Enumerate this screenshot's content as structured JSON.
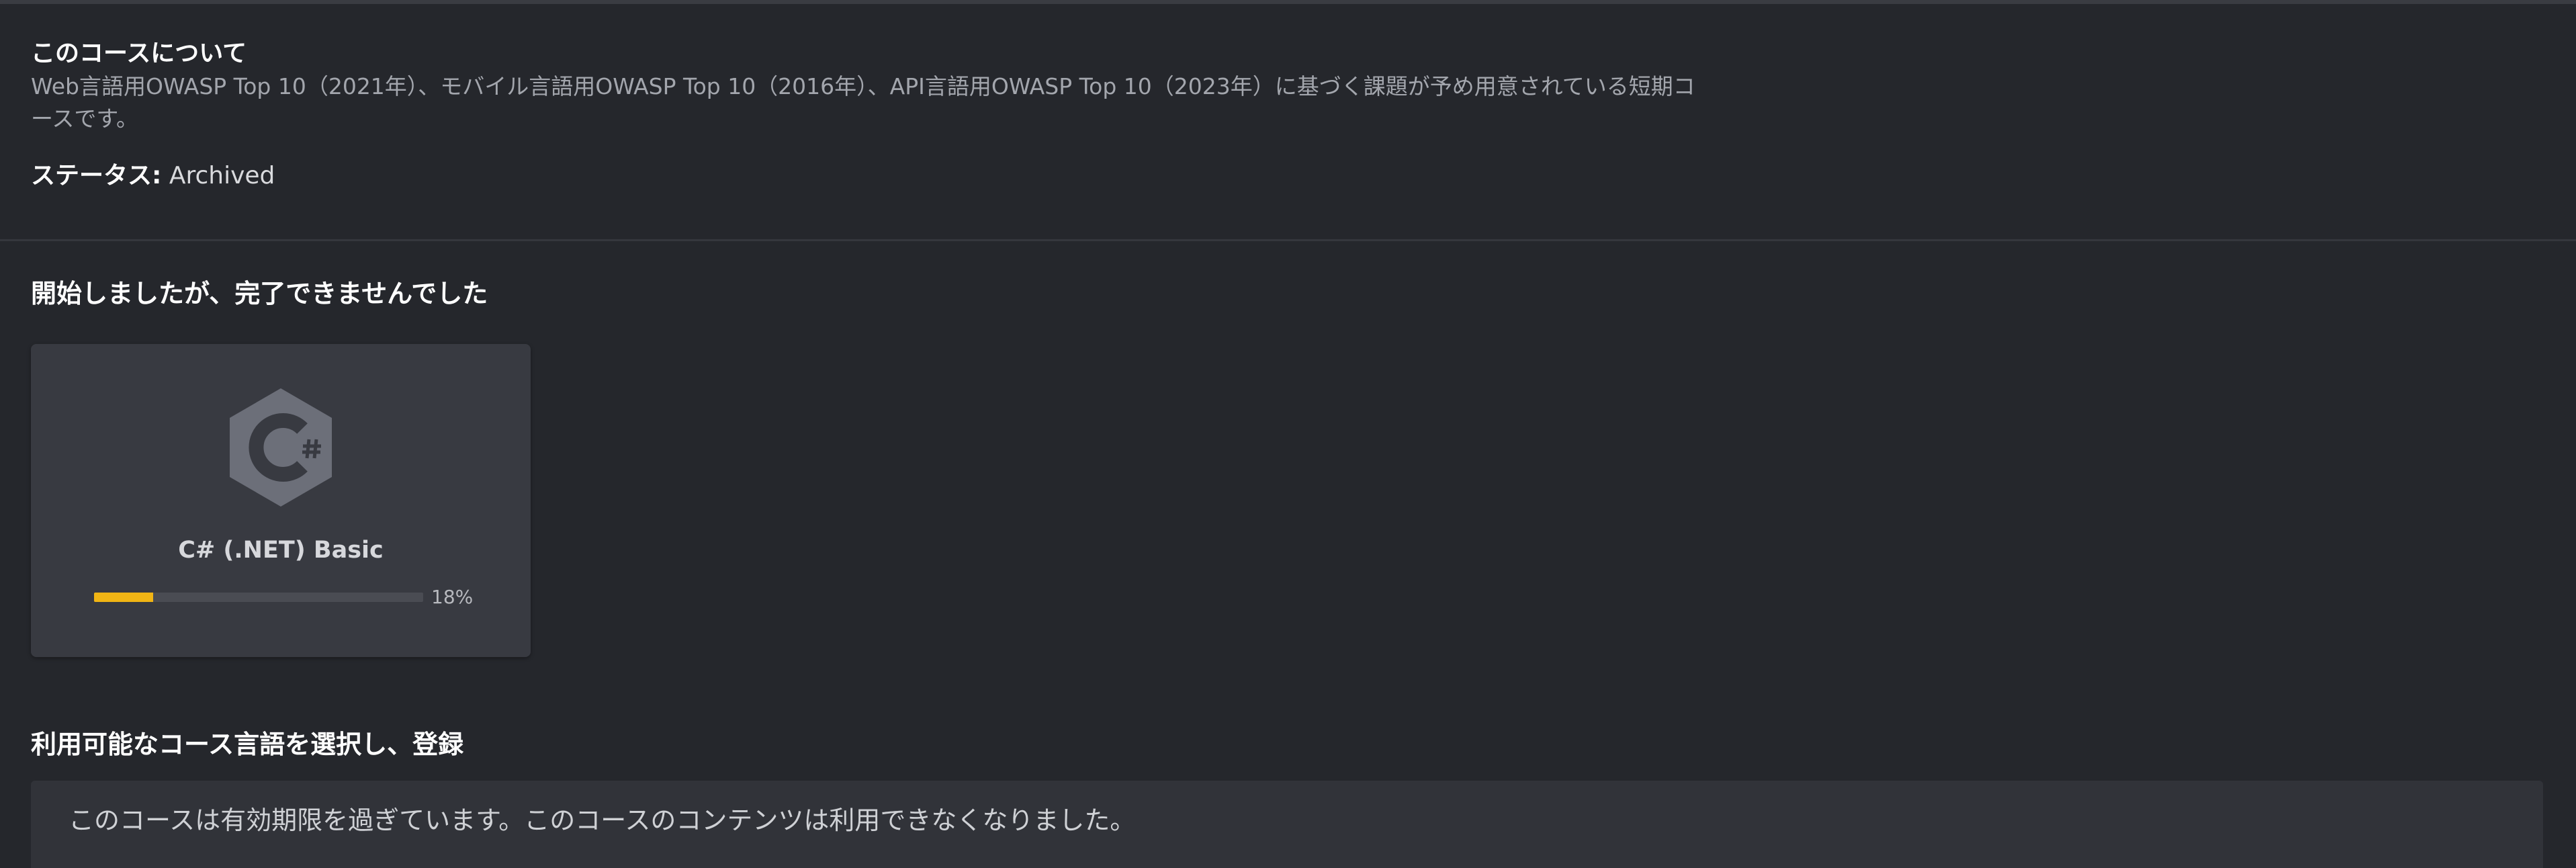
{
  "about": {
    "title": "このコースについて",
    "description": "Web言語用OWASP Top 10（2021年）、モバイル言語用OWASP Top 10（2016年）、API言語用OWASP Top 10（2023年）に基づく課題が予め用意されている短期コースです。",
    "status_label": "ステータス:",
    "status_value": "Archived"
  },
  "started_section": {
    "heading": "開始しましたが、完了できませんでした",
    "courses": [
      {
        "name": "C# (.NET) Basic",
        "icon": "csharp-logo-icon",
        "progress": 18,
        "progress_text": "18%",
        "progress_color": "#f1b514"
      }
    ]
  },
  "select_section": {
    "heading": "利用可能なコース言語を選択し、登録",
    "notice": "このコースは有効期限を過ぎています。このコースのコンテンツは利用できなくなりました。"
  }
}
